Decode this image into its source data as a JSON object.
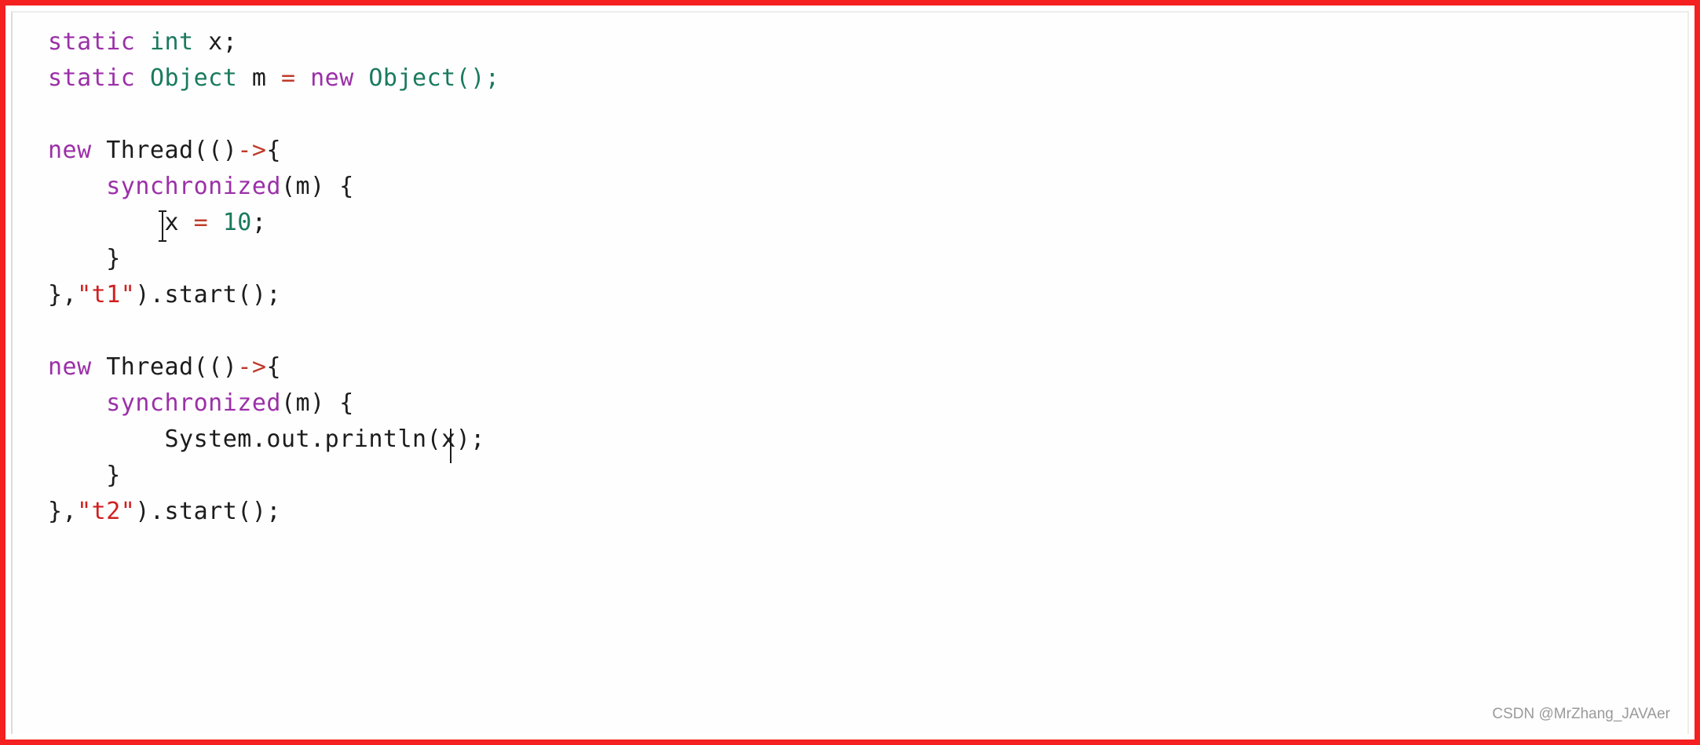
{
  "window": {
    "border_color": "#f52020",
    "background": "#ffffff"
  },
  "editor": {
    "language": "java",
    "caret": {
      "visible": true,
      "after_line_index": 10,
      "symbol": "|"
    },
    "mouse_pointer": {
      "type": "i-beam",
      "over_line_index": 4,
      "over_token": "x"
    },
    "colors": {
      "keyword": "#9b30a8",
      "type": "#1a7a5e",
      "string": "#d02020",
      "number": "#1a7a5e",
      "operator": "#c0392b",
      "plain": "#1c1c1c"
    },
    "lines": [
      {
        "index": 0,
        "text": "static int x;",
        "tokens": [
          {
            "t": "static",
            "k": "kw"
          },
          {
            "t": " ",
            "k": "plain"
          },
          {
            "t": "int",
            "k": "type"
          },
          {
            "t": " x;",
            "k": "plain"
          }
        ]
      },
      {
        "index": 1,
        "text": "static Object m = new Object();",
        "tokens": [
          {
            "t": "static",
            "k": "kw"
          },
          {
            "t": " ",
            "k": "plain"
          },
          {
            "t": "Object",
            "k": "type"
          },
          {
            "t": " m ",
            "k": "plain"
          },
          {
            "t": "=",
            "k": "op"
          },
          {
            "t": " ",
            "k": "plain"
          },
          {
            "t": "new",
            "k": "kw"
          },
          {
            "t": " ",
            "k": "plain"
          },
          {
            "t": "Object();",
            "k": "type"
          }
        ]
      },
      {
        "index": 2,
        "text": "",
        "tokens": []
      },
      {
        "index": 3,
        "text": "new Thread(()->{",
        "tokens": [
          {
            "t": "new",
            "k": "kw"
          },
          {
            "t": " Thread(()",
            "k": "plain"
          },
          {
            "t": "->",
            "k": "op"
          },
          {
            "t": "{",
            "k": "plain"
          }
        ]
      },
      {
        "index": 4,
        "text": "    synchronized(m) {",
        "tokens": [
          {
            "t": "    ",
            "k": "plain"
          },
          {
            "t": "synchronized",
            "k": "kw"
          },
          {
            "t": "(m) {",
            "k": "plain"
          }
        ]
      },
      {
        "index": 5,
        "text": "        x = 10;",
        "tokens": [
          {
            "t": "        x ",
            "k": "plain"
          },
          {
            "t": "=",
            "k": "op"
          },
          {
            "t": " ",
            "k": "plain"
          },
          {
            "t": "10",
            "k": "num"
          },
          {
            "t": ";",
            "k": "plain"
          }
        ]
      },
      {
        "index": 6,
        "text": "    }",
        "tokens": [
          {
            "t": "    }",
            "k": "plain"
          }
        ]
      },
      {
        "index": 7,
        "text": "},\"t1\").start();",
        "tokens": [
          {
            "t": "},",
            "k": "plain"
          },
          {
            "t": "\"t1\"",
            "k": "str"
          },
          {
            "t": ").start();",
            "k": "plain"
          }
        ]
      },
      {
        "index": 8,
        "text": "",
        "tokens": []
      },
      {
        "index": 9,
        "text": "new Thread(()->{",
        "tokens": [
          {
            "t": "new",
            "k": "kw"
          },
          {
            "t": " Thread(()",
            "k": "plain"
          },
          {
            "t": "->",
            "k": "op"
          },
          {
            "t": "{",
            "k": "plain"
          }
        ]
      },
      {
        "index": 10,
        "text": "    synchronized(m) {",
        "tokens": [
          {
            "t": "    ",
            "k": "plain"
          },
          {
            "t": "synchronized",
            "k": "kw"
          },
          {
            "t": "(m) {",
            "k": "plain"
          }
        ]
      },
      {
        "index": 11,
        "text": "        System.out.println(x);",
        "tokens": [
          {
            "t": "        System.out.println(x);",
            "k": "plain"
          }
        ]
      },
      {
        "index": 12,
        "text": "    }",
        "tokens": [
          {
            "t": "    }",
            "k": "plain"
          }
        ]
      },
      {
        "index": 13,
        "text": "},\"t2\").start();",
        "tokens": [
          {
            "t": "},",
            "k": "plain"
          },
          {
            "t": "\"t2\"",
            "k": "str"
          },
          {
            "t": ").start();",
            "k": "plain"
          }
        ]
      }
    ]
  },
  "watermark": {
    "text": "CSDN @MrZhang_JAVAer"
  }
}
